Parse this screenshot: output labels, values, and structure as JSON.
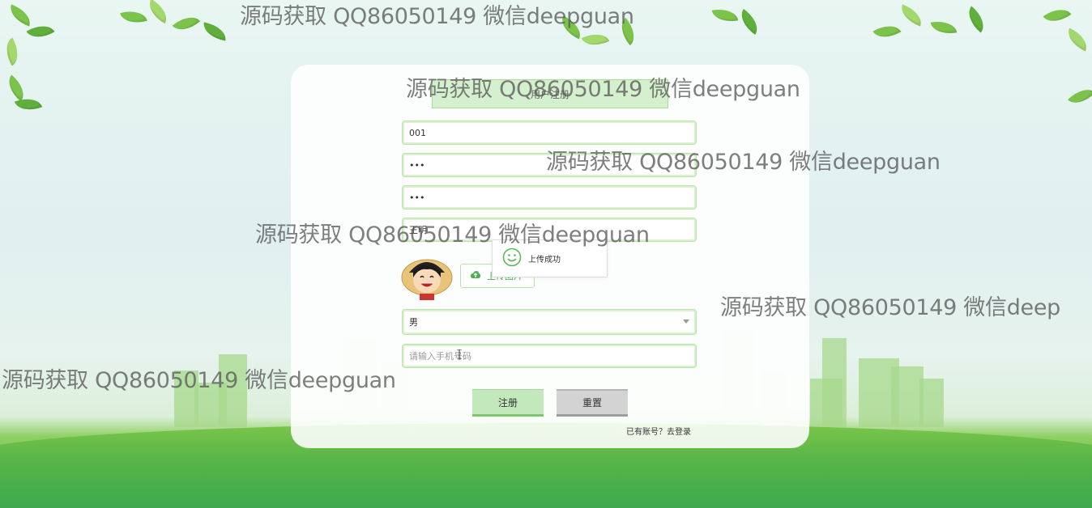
{
  "form": {
    "title_placeholder": "用户注册",
    "username_value": "001",
    "password_value": "•••",
    "confirm_password_value": "•••",
    "name_value": "王明",
    "upload_button_label": "上传图片",
    "upload_toast": "上传成功",
    "gender_value": "男",
    "phone_placeholder": "请输入手机号码",
    "register_button": "注册",
    "reset_button": "重置",
    "login_link": "已有账号？去登录"
  },
  "watermark": {
    "text_1": "源码获取 QQ86050149 微信deepguan",
    "text_2": "源码获取 QQ86050149 微信deepguan",
    "text_3": "源码获取 QQ86050149 微信deepguan",
    "text_4": "源码获取 QQ86050149 微信deepguan",
    "text_5": "源码获取 QQ86050149 微信deep",
    "text_6": "源码获取 QQ86050149 微信deepguan"
  },
  "colors": {
    "accent_green": "#7cc66b",
    "field_border": "#b9e3a9",
    "reset_gray": "#d3d3d3"
  },
  "icons": {
    "upload": "cloud-upload-icon",
    "toast": "smile-icon",
    "select": "chevron-down-icon"
  }
}
